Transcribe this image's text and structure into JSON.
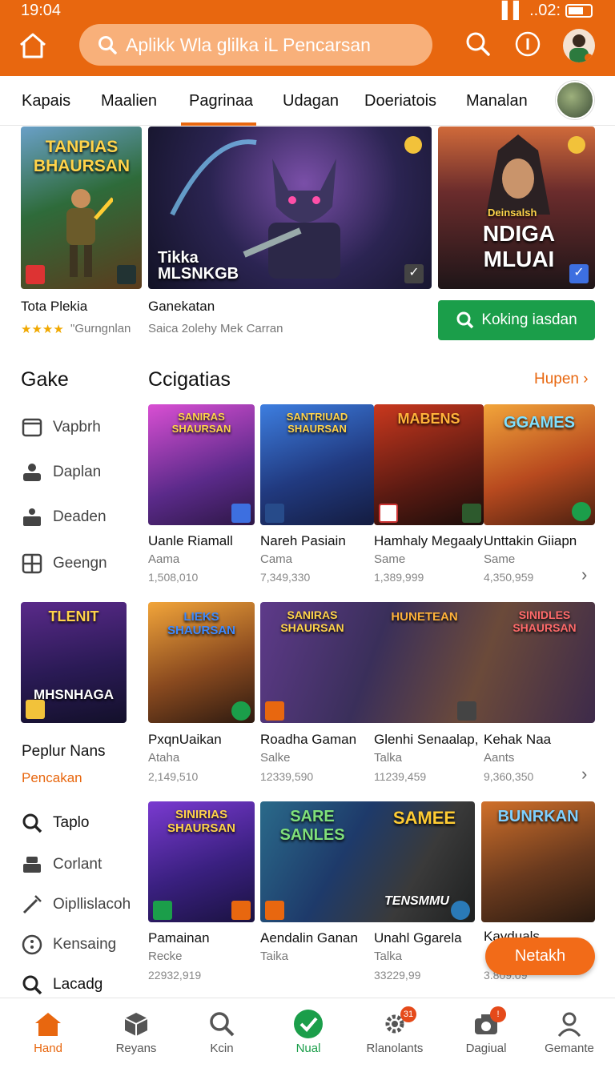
{
  "status": {
    "time": "19:04",
    "right": "..02:"
  },
  "header": {
    "search_placeholder": "Aplikk Wla glilka iL Pencarsan"
  },
  "tabs": [
    "Kapais",
    "Maalien",
    "Pagrinaa",
    "Udagan",
    "Doeriatois",
    "Manalan"
  ],
  "active_tab": 2,
  "featured": {
    "art1_title": "TANPIAS BHAURSAN",
    "art2_title": "Tikka MLSNKGB",
    "art3_caption": "Deinsalsh",
    "art3_title": "NDIGA MLUAI",
    "left_label": "Tota Plekia",
    "left_rating": "★★★★",
    "left_sub": "\"Gurngnlan",
    "mid_label": "Ganekatan",
    "mid_sub": "Saica 2olehy Mek Carran",
    "find_button": "Koking iasdan"
  },
  "section": {
    "left_title": "Gake",
    "title": "Ccigatias",
    "see_more": "Hupen"
  },
  "sidebar_top": [
    "Vapbrh",
    "Daplan",
    "Deaden",
    "Geengn"
  ],
  "sidebar_bottom": [
    "Taplo",
    "Corlant",
    "Oipllislacoh",
    "Kensaing",
    "Lacadg"
  ],
  "promo": {
    "art_title": "TLENIT",
    "art_sub": "MHSNHAGA",
    "label": "Peplur Nans",
    "link": "Pencakan"
  },
  "row1": [
    {
      "art": "SANIRAS SHAURSAN",
      "name": "Uanle Riamall",
      "sub": "Aama",
      "num": "1,508,010"
    },
    {
      "art": "SANTRIUAD SHAURSAN",
      "name": "Nareh Pasiain",
      "sub": "Cama",
      "num": "7,349,330"
    },
    {
      "art": "MABENS",
      "name": "Hamhaly Megaaly",
      "sub": "Same",
      "num": "1,389,999"
    },
    {
      "art": "GGAMES",
      "name": "Unttakin Giiapn",
      "sub": "Same",
      "num": "4,350,959"
    }
  ],
  "row2": [
    {
      "art": "LIEKS SHAURSAN",
      "name": "PxqnUaikan",
      "sub": "Ataha",
      "num": "2,149,510"
    },
    {
      "art": "SANIRAS SHAURSAN",
      "name": "Roadha Gaman",
      "sub": "Salke",
      "num": "12339,590"
    },
    {
      "art": "HUNETEAN",
      "name": "Glenhi Senaalap,",
      "sub": "Talka",
      "num": "11239,459"
    },
    {
      "art": "SINIDLES SHAURSAN",
      "name": "Kehak Naa",
      "sub": "Aants",
      "num": "9,360,350"
    }
  ],
  "row3": [
    {
      "art": "SINIRIAS SHAURSAN",
      "name": "Pamainan",
      "sub": "Recke",
      "num": "22932,919"
    },
    {
      "art": "SARE SANLES",
      "name": "Aendalin Ganan",
      "sub": "Taika",
      "num": ""
    },
    {
      "art": "SAMEE",
      "name": "Unahl Ggarela",
      "sub": "Talka",
      "num": "33229,99"
    },
    {
      "art": "BUNRKAN",
      "name": "Kayduals",
      "sub": "",
      "num": "3.809.09"
    }
  ],
  "row3_art_overlay": "TENSMMU",
  "fab": "Netakh",
  "bottom_nav": [
    {
      "label": "Hand",
      "icon": "home-icon",
      "badge": ""
    },
    {
      "label": "Reyans",
      "icon": "box-icon",
      "badge": ""
    },
    {
      "label": "Kcin",
      "icon": "search-icon",
      "badge": ""
    },
    {
      "label": "Nual",
      "icon": "check-circle-icon",
      "badge": ""
    },
    {
      "label": "Rlanolants",
      "icon": "gear-icon",
      "badge": "31"
    },
    {
      "label": "Dagiual",
      "icon": "camera-icon",
      "badge": "!"
    },
    {
      "label": "Gemante",
      "icon": "person-icon",
      "badge": ""
    }
  ],
  "colors": {
    "accent": "#e8670f",
    "green": "#1b9e4a"
  }
}
